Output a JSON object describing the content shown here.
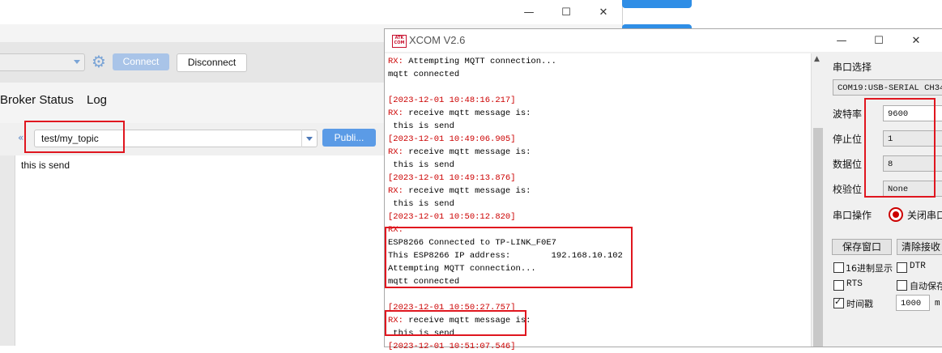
{
  "mqtt_client": {
    "window_controls": {
      "minimize": "—",
      "maximize": "☐",
      "close": "✕"
    },
    "toolbar": {
      "connect_label": "Connect",
      "disconnect_label": "Disconnect"
    },
    "tabs": [
      "Broker Status",
      "Log"
    ],
    "publish": {
      "topic_value": "test/my_topic",
      "publish_label": "Publi..."
    },
    "payload_text": "this is send"
  },
  "xcom": {
    "title": "XCOM V2.6",
    "logo_text": "ATK COM",
    "window_controls": {
      "minimize": "—",
      "maximize": "☐",
      "close": "✕"
    },
    "terminal_lines": [
      {
        "kind": "rx",
        "prefix": "RX:",
        "text": " Attempting MQTT connection..."
      },
      {
        "kind": "norm",
        "prefix": "",
        "text": "mqtt connected"
      },
      {
        "kind": "blank",
        "prefix": "",
        "text": ""
      },
      {
        "kind": "ts",
        "prefix": "",
        "text": "[2023-12-01 10:48:16.217]"
      },
      {
        "kind": "rx",
        "prefix": "RX:",
        "text": " receive mqtt message is:"
      },
      {
        "kind": "norm",
        "prefix": "",
        "text": " this is send"
      },
      {
        "kind": "ts",
        "prefix": "",
        "text": "[2023-12-01 10:49:06.905]"
      },
      {
        "kind": "rx",
        "prefix": "RX:",
        "text": " receive mqtt message is:"
      },
      {
        "kind": "norm",
        "prefix": "",
        "text": " this is send"
      },
      {
        "kind": "ts",
        "prefix": "",
        "text": "[2023-12-01 10:49:13.876]"
      },
      {
        "kind": "rx",
        "prefix": "RX:",
        "text": " receive mqtt message is:"
      },
      {
        "kind": "norm",
        "prefix": "",
        "text": " this is send"
      },
      {
        "kind": "ts",
        "prefix": "",
        "text": "[2023-12-01 10:50:12.820]"
      },
      {
        "kind": "rx",
        "prefix": "RX:",
        "text": ""
      },
      {
        "kind": "norm",
        "prefix": "",
        "text": "ESP8266 Connected to TP-LINK_F0E7"
      },
      {
        "kind": "norm",
        "prefix": "",
        "text": "This ESP8266 IP address:        192.168.10.102"
      },
      {
        "kind": "norm",
        "prefix": "",
        "text": "Attempting MQTT connection..."
      },
      {
        "kind": "norm",
        "prefix": "",
        "text": "mqtt connected"
      },
      {
        "kind": "blank",
        "prefix": "",
        "text": ""
      },
      {
        "kind": "ts",
        "prefix": "",
        "text": "[2023-12-01 10:50:27.757]"
      },
      {
        "kind": "rx",
        "prefix": "RX:",
        "text": " receive mqtt message is:"
      },
      {
        "kind": "norm",
        "prefix": "",
        "text": " this is send"
      },
      {
        "kind": "ts",
        "prefix": "",
        "text": "[2023-12-01 10:51:07.546]"
      }
    ],
    "side": {
      "port_select_label": "串口选择",
      "port_value": "COM19:USB-SERIAL CH34",
      "baud_label": "波特率",
      "baud_value": "9600",
      "stopbits_label": "停止位",
      "stopbits_value": "1",
      "databits_label": "数据位",
      "databits_value": "8",
      "parity_label": "校验位",
      "parity_value": "None",
      "port_op_label": "串口操作",
      "port_op_button": "关闭串口",
      "save_window_button": "保存窗口",
      "clear_rx_button": "清除接收",
      "hex_display_label": "16进制显示",
      "dtr_label": "DTR",
      "rts_label": "RTS",
      "auto_save_label": "自动保存",
      "timestamp_label": "时间戳",
      "timestamp_value": "1000",
      "timestamp_unit": "m",
      "hex_display_checked": false,
      "dtr_checked": false,
      "rts_checked": false,
      "auto_save_checked": false,
      "timestamp_checked": true
    }
  },
  "colors": {
    "accent_blue": "#2f8ee6",
    "highlight_red": "#e0161f",
    "rx_red": "#cc0000"
  }
}
